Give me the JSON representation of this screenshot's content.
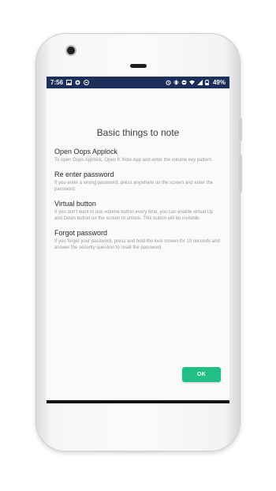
{
  "statusbar": {
    "time": "7:56",
    "battery": "49%",
    "left_icons": [
      "image-icon",
      "record-icon",
      "vpn-icon"
    ],
    "right_icons": [
      "alarm-icon",
      "vibrate-icon",
      "dnd-icon",
      "wifi-icon",
      "signal-icon",
      "battery-icon"
    ]
  },
  "dialog": {
    "title": "Basic things to note",
    "sections": [
      {
        "heading": "Open Oops Applock",
        "body": "To open Oops Applock, Open K Note App and enter the volume key pattern."
      },
      {
        "heading": "Re enter password",
        "body": "If you enter a wrong password, press anywhere on the screen and enter the password."
      },
      {
        "heading": "Virtual button",
        "body": "If you don't want to use volume button every time, you can enable virtual Up and Down button on the screen to unlock. This button will be invisible."
      },
      {
        "heading": "Forgot password",
        "body": "If you forget your password, press and hold the lock screen for 10 seconds and answer the security question to reset the password"
      }
    ],
    "ok_label": "OK"
  },
  "colors": {
    "statusbar": "#1b2f5a",
    "accent": "#1fbf86",
    "screen_bg": "#fafafa"
  }
}
